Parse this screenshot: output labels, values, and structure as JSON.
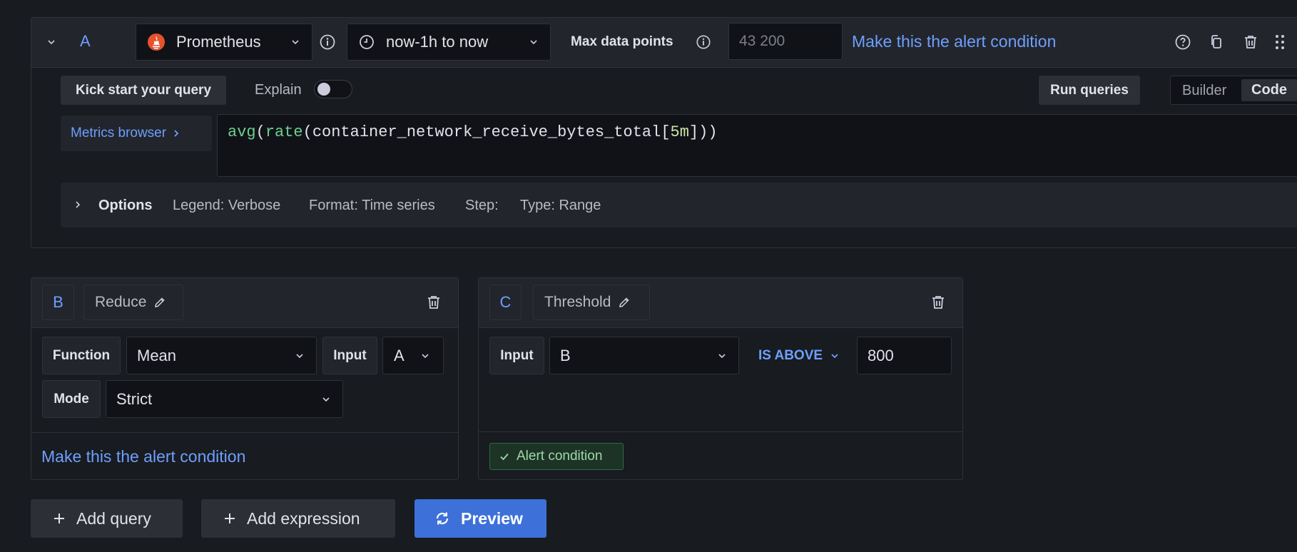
{
  "query_a": {
    "ref_id": "A",
    "datasource": "Prometheus",
    "time_range": "now-1h to now",
    "max_data_points_label": "Max data points",
    "max_data_points_placeholder": "43 200",
    "alert_condition_link": "Make this the alert condition",
    "kick_start_label": "Kick start your query",
    "explain_label": "Explain",
    "run_queries_label": "Run queries",
    "mode_builder": "Builder",
    "mode_code": "Code",
    "metrics_browser_label": "Metrics browser",
    "expression": {
      "fn_avg": "avg",
      "fn_rate": "rate",
      "metric": "container_network_receive_bytes_total",
      "range": "5m"
    },
    "options": {
      "label": "Options",
      "legend": "Legend: Verbose",
      "format": "Format: Time series",
      "step": "Step:",
      "type": "Type: Range"
    }
  },
  "expr_b": {
    "ref_id": "B",
    "name": "Reduce",
    "function_label": "Function",
    "function_value": "Mean",
    "input_label": "Input",
    "input_value": "A",
    "mode_label": "Mode",
    "mode_value": "Strict",
    "alert_condition_link": "Make this the alert condition"
  },
  "expr_c": {
    "ref_id": "C",
    "name": "Threshold",
    "input_label": "Input",
    "input_value": "B",
    "operator": "IS ABOVE",
    "threshold_value": "800",
    "alert_condition_badge": "Alert condition"
  },
  "actions": {
    "add_query": "Add query",
    "add_expression": "Add expression",
    "preview": "Preview"
  },
  "colors": {
    "background": "#181b1f",
    "panel_header": "#22252b",
    "link_blue": "#6e9fff",
    "primary_blue": "#3d71d9",
    "code_function": "#6ccf8e",
    "success_green": "#6ccf8e"
  },
  "icons": {
    "collapse": "chevron-down-icon",
    "datasource": "prometheus-logo-icon",
    "info": "info-circle-icon",
    "clock": "clock-icon",
    "help": "question-circle-icon",
    "duplicate": "copy-icon",
    "delete": "trash-icon",
    "drag": "drag-handle-icon",
    "edit": "pencil-icon",
    "add": "plus-icon",
    "preview": "sync-icon",
    "check": "check-icon"
  }
}
